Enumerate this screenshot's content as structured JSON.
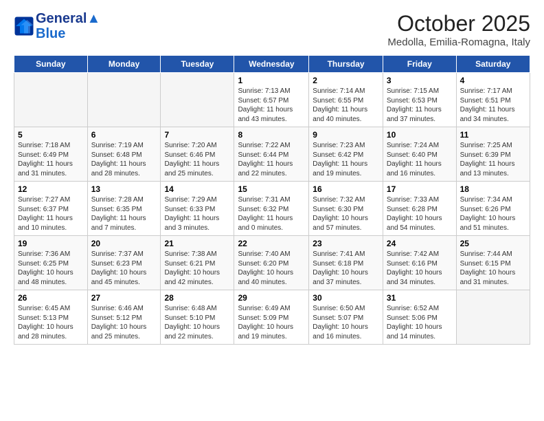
{
  "header": {
    "logo_line1": "General",
    "logo_line2": "Blue",
    "title": "October 2025",
    "subtitle": "Medolla, Emilia-Romagna, Italy"
  },
  "days_of_week": [
    "Sunday",
    "Monday",
    "Tuesday",
    "Wednesday",
    "Thursday",
    "Friday",
    "Saturday"
  ],
  "weeks": [
    {
      "days": [
        {
          "num": "",
          "info": "",
          "empty": true
        },
        {
          "num": "",
          "info": "",
          "empty": true
        },
        {
          "num": "",
          "info": "",
          "empty": true
        },
        {
          "num": "1",
          "info": "Sunrise: 7:13 AM\nSunset: 6:57 PM\nDaylight: 11 hours\nand 43 minutes."
        },
        {
          "num": "2",
          "info": "Sunrise: 7:14 AM\nSunset: 6:55 PM\nDaylight: 11 hours\nand 40 minutes."
        },
        {
          "num": "3",
          "info": "Sunrise: 7:15 AM\nSunset: 6:53 PM\nDaylight: 11 hours\nand 37 minutes."
        },
        {
          "num": "4",
          "info": "Sunrise: 7:17 AM\nSunset: 6:51 PM\nDaylight: 11 hours\nand 34 minutes."
        }
      ]
    },
    {
      "days": [
        {
          "num": "5",
          "info": "Sunrise: 7:18 AM\nSunset: 6:49 PM\nDaylight: 11 hours\nand 31 minutes."
        },
        {
          "num": "6",
          "info": "Sunrise: 7:19 AM\nSunset: 6:48 PM\nDaylight: 11 hours\nand 28 minutes."
        },
        {
          "num": "7",
          "info": "Sunrise: 7:20 AM\nSunset: 6:46 PM\nDaylight: 11 hours\nand 25 minutes."
        },
        {
          "num": "8",
          "info": "Sunrise: 7:22 AM\nSunset: 6:44 PM\nDaylight: 11 hours\nand 22 minutes."
        },
        {
          "num": "9",
          "info": "Sunrise: 7:23 AM\nSunset: 6:42 PM\nDaylight: 11 hours\nand 19 minutes."
        },
        {
          "num": "10",
          "info": "Sunrise: 7:24 AM\nSunset: 6:40 PM\nDaylight: 11 hours\nand 16 minutes."
        },
        {
          "num": "11",
          "info": "Sunrise: 7:25 AM\nSunset: 6:39 PM\nDaylight: 11 hours\nand 13 minutes."
        }
      ]
    },
    {
      "days": [
        {
          "num": "12",
          "info": "Sunrise: 7:27 AM\nSunset: 6:37 PM\nDaylight: 11 hours\nand 10 minutes."
        },
        {
          "num": "13",
          "info": "Sunrise: 7:28 AM\nSunset: 6:35 PM\nDaylight: 11 hours\nand 7 minutes."
        },
        {
          "num": "14",
          "info": "Sunrise: 7:29 AM\nSunset: 6:33 PM\nDaylight: 11 hours\nand 3 minutes."
        },
        {
          "num": "15",
          "info": "Sunrise: 7:31 AM\nSunset: 6:32 PM\nDaylight: 11 hours\nand 0 minutes."
        },
        {
          "num": "16",
          "info": "Sunrise: 7:32 AM\nSunset: 6:30 PM\nDaylight: 10 hours\nand 57 minutes."
        },
        {
          "num": "17",
          "info": "Sunrise: 7:33 AM\nSunset: 6:28 PM\nDaylight: 10 hours\nand 54 minutes."
        },
        {
          "num": "18",
          "info": "Sunrise: 7:34 AM\nSunset: 6:26 PM\nDaylight: 10 hours\nand 51 minutes."
        }
      ]
    },
    {
      "days": [
        {
          "num": "19",
          "info": "Sunrise: 7:36 AM\nSunset: 6:25 PM\nDaylight: 10 hours\nand 48 minutes."
        },
        {
          "num": "20",
          "info": "Sunrise: 7:37 AM\nSunset: 6:23 PM\nDaylight: 10 hours\nand 45 minutes."
        },
        {
          "num": "21",
          "info": "Sunrise: 7:38 AM\nSunset: 6:21 PM\nDaylight: 10 hours\nand 42 minutes."
        },
        {
          "num": "22",
          "info": "Sunrise: 7:40 AM\nSunset: 6:20 PM\nDaylight: 10 hours\nand 40 minutes."
        },
        {
          "num": "23",
          "info": "Sunrise: 7:41 AM\nSunset: 6:18 PM\nDaylight: 10 hours\nand 37 minutes."
        },
        {
          "num": "24",
          "info": "Sunrise: 7:42 AM\nSunset: 6:16 PM\nDaylight: 10 hours\nand 34 minutes."
        },
        {
          "num": "25",
          "info": "Sunrise: 7:44 AM\nSunset: 6:15 PM\nDaylight: 10 hours\nand 31 minutes."
        }
      ]
    },
    {
      "days": [
        {
          "num": "26",
          "info": "Sunrise: 6:45 AM\nSunset: 5:13 PM\nDaylight: 10 hours\nand 28 minutes."
        },
        {
          "num": "27",
          "info": "Sunrise: 6:46 AM\nSunset: 5:12 PM\nDaylight: 10 hours\nand 25 minutes."
        },
        {
          "num": "28",
          "info": "Sunrise: 6:48 AM\nSunset: 5:10 PM\nDaylight: 10 hours\nand 22 minutes."
        },
        {
          "num": "29",
          "info": "Sunrise: 6:49 AM\nSunset: 5:09 PM\nDaylight: 10 hours\nand 19 minutes."
        },
        {
          "num": "30",
          "info": "Sunrise: 6:50 AM\nSunset: 5:07 PM\nDaylight: 10 hours\nand 16 minutes."
        },
        {
          "num": "31",
          "info": "Sunrise: 6:52 AM\nSunset: 5:06 PM\nDaylight: 10 hours\nand 14 minutes."
        },
        {
          "num": "",
          "info": "",
          "empty": true
        }
      ]
    }
  ]
}
